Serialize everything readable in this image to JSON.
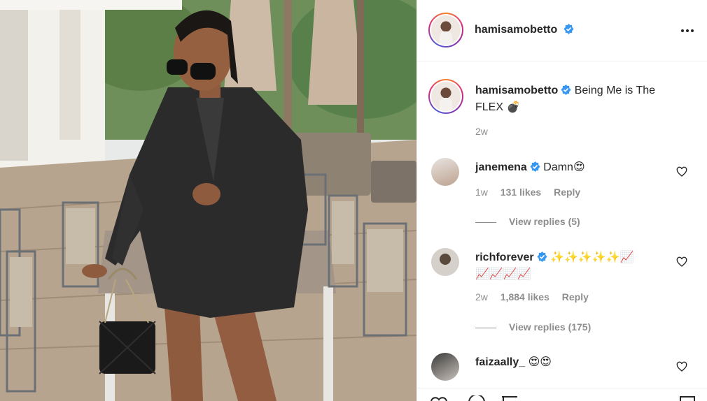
{
  "post": {
    "image_alt": "Woman in black shirt dress holding quilted handbag on a patio",
    "author": "hamisamobetto",
    "author_verified": true
  },
  "header": {
    "username": "hamisamobetto",
    "more_icon": "more-options-icon"
  },
  "caption": {
    "username": "hamisamobetto",
    "text_line1": "Being Me is The",
    "text_line2": "FLEX",
    "emoji": "💣",
    "age": "2w"
  },
  "comments": [
    {
      "username": "janemena",
      "verified": true,
      "text": "Damn",
      "emoji": "😍",
      "age": "1w",
      "likes": "131 likes",
      "reply_label": "Reply",
      "view_replies": "View replies (5)"
    },
    {
      "username": "richforever",
      "verified": true,
      "emoji_line1": "✨✨✨✨✨📈",
      "emoji_line2": "📈📈📈📈",
      "age": "2w",
      "likes": "1,884 likes",
      "reply_label": "Reply",
      "view_replies": "View replies (175)"
    },
    {
      "username": "faizaally_",
      "verified": false,
      "emoji": "😍😍"
    }
  ],
  "colors": {
    "verified_blue": "#3897f0",
    "text": "#262626",
    "muted": "#8e8e8e",
    "border": "#efefef"
  }
}
